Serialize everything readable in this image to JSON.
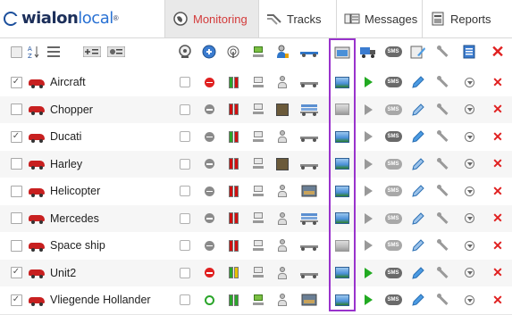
{
  "app": {
    "logo_part1": "wialon",
    "logo_part2": "local",
    "logo_mark": "®"
  },
  "tabs": [
    {
      "label": "Monitoring",
      "icon": "globe-icon",
      "active": true
    },
    {
      "label": "Tracks",
      "icon": "tracks-icon",
      "active": false
    },
    {
      "label": "Messages",
      "icon": "messages-icon",
      "active": false
    },
    {
      "label": "Reports",
      "icon": "reports-icon",
      "active": false
    }
  ],
  "toolbar": {
    "sort_label": "A↓Z",
    "list_icon": "list-icon",
    "add_group_icon": "add-group-icon",
    "toggle_icon": "toggle-icon"
  },
  "columns": [
    "locate-icon",
    "target-icon",
    "antenna-icon",
    "connection-icon",
    "driver-icon",
    "trailer-icon",
    "photo-folder-icon",
    "truck-icon",
    "sms-icon",
    "edit-icon",
    "tools-icon",
    "report-icon",
    "delete-icon"
  ],
  "colors": {
    "accent": "#d33a3a",
    "highlight": "#9933cc",
    "green": "#22aa22",
    "red": "#e02020",
    "blue": "#2a72d4"
  },
  "units": [
    {
      "name": "Aircraft",
      "checked": true,
      "state": "stopped-red",
      "bars": [
        "#2aa52a",
        "#d01010"
      ],
      "monitor": "gray",
      "driver": "person",
      "trailer": "flat",
      "image": "color",
      "play": "green",
      "sms": "dark",
      "edit": "color"
    },
    {
      "name": "Chopper",
      "checked": false,
      "state": "stopped-gray",
      "bars": [
        "#d01010",
        "#d01010"
      ],
      "monitor": "gray",
      "driver": "photo",
      "trailer": "stack",
      "image": "dim",
      "play": "dim",
      "sms": "dim",
      "edit": "dim"
    },
    {
      "name": "Ducati",
      "checked": true,
      "state": "stopped-gray",
      "bars": [
        "#2aa52a",
        "#d01010"
      ],
      "monitor": "gray",
      "driver": "person",
      "trailer": "flat",
      "image": "color",
      "play": "dim",
      "sms": "dark",
      "edit": "color"
    },
    {
      "name": "Harley",
      "checked": false,
      "state": "stopped-gray",
      "bars": [
        "#d01010",
        "#d01010"
      ],
      "monitor": "gray",
      "driver": "photo",
      "trailer": "flat",
      "image": "color",
      "play": "dim",
      "sms": "dim",
      "edit": "dim"
    },
    {
      "name": "Helicopter",
      "checked": false,
      "state": "stopped-gray",
      "bars": [
        "#d01010",
        "#d01010"
      ],
      "monitor": "gray",
      "driver": "person",
      "trailer": "photo",
      "image": "color",
      "play": "dim",
      "sms": "dim",
      "edit": "dim"
    },
    {
      "name": "Mercedes",
      "checked": false,
      "state": "stopped-gray",
      "bars": [
        "#d01010",
        "#d01010"
      ],
      "monitor": "gray",
      "driver": "person",
      "trailer": "stack",
      "image": "color",
      "play": "dim",
      "sms": "dim",
      "edit": "dim"
    },
    {
      "name": "Space ship",
      "checked": false,
      "state": "stopped-gray",
      "bars": [
        "#d01010",
        "#d01010"
      ],
      "monitor": "gray",
      "driver": "person",
      "trailer": "flat",
      "image": "dim",
      "play": "dim",
      "sms": "dim",
      "edit": "dim"
    },
    {
      "name": "Unit2",
      "checked": true,
      "state": "stopped-red",
      "bars": [
        "#2aa52a",
        "#e8c000"
      ],
      "monitor": "gray",
      "driver": "person",
      "trailer": "flat",
      "image": "color",
      "play": "green",
      "sms": "dark",
      "edit": "color"
    },
    {
      "name": "Vliegende Hollander",
      "checked": true,
      "state": "moving",
      "bars": [
        "#2aa52a",
        "#2aa52a"
      ],
      "monitor": "green",
      "driver": "person",
      "trailer": "photo",
      "image": "color",
      "play": "green",
      "sms": "dark",
      "edit": "color"
    }
  ],
  "sms_text": "SMS",
  "delete_glyph": "✕",
  "check_glyph": "✓"
}
